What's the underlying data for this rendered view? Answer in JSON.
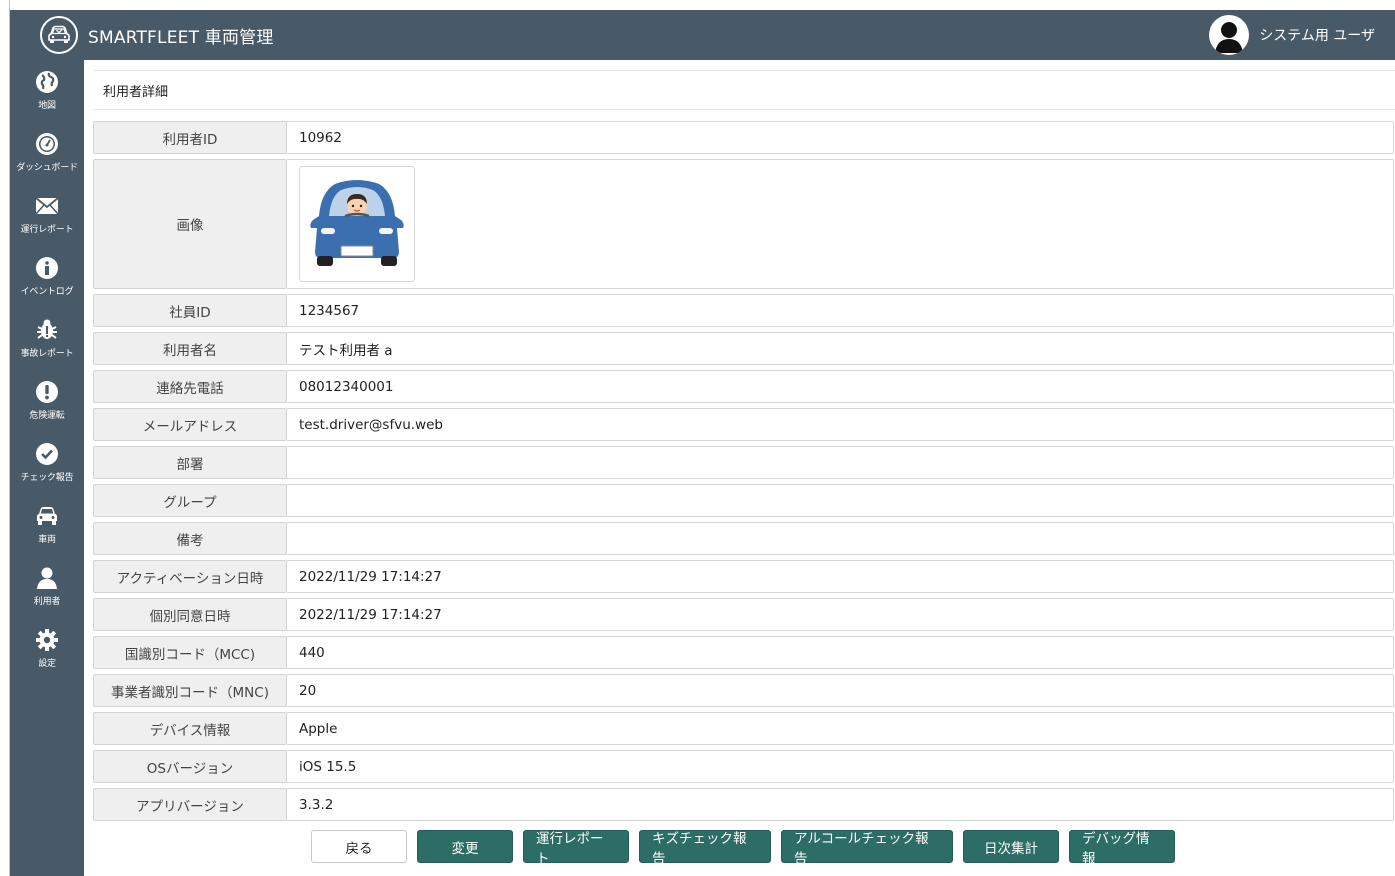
{
  "header": {
    "app_title": "SMARTFLEET 車両管理",
    "user_name": "システム用 ユーザ"
  },
  "sidebar": {
    "items": [
      {
        "label": "地図",
        "icon": "globe-icon"
      },
      {
        "label": "ダッシュボード",
        "icon": "dashboard-icon"
      },
      {
        "label": "運行レポート",
        "icon": "envelope-icon"
      },
      {
        "label": "イベントログ",
        "icon": "info-icon"
      },
      {
        "label": "事故レポート",
        "icon": "bug-icon"
      },
      {
        "label": "危険運転",
        "icon": "exclamation-icon"
      },
      {
        "label": "チェック報告",
        "icon": "check-circle-icon"
      },
      {
        "label": "車両",
        "icon": "car-icon"
      },
      {
        "label": "利用者",
        "icon": "user-icon"
      },
      {
        "label": "設定",
        "icon": "gear-icon"
      }
    ]
  },
  "page": {
    "title": "利用者詳細"
  },
  "details": {
    "user_id": {
      "label": "利用者ID",
      "value": "10962"
    },
    "image": {
      "label": "画像"
    },
    "employee_id": {
      "label": "社員ID",
      "value": "1234567"
    },
    "user_name": {
      "label": "利用者名",
      "value": "テスト利用者 a"
    },
    "phone": {
      "label": "連絡先電話",
      "value": "08012340001"
    },
    "email": {
      "label": "メールアドレス",
      "value": "test.driver@sfvu.web"
    },
    "department": {
      "label": "部署",
      "value": ""
    },
    "group": {
      "label": "グループ",
      "value": ""
    },
    "notes": {
      "label": "備考",
      "value": ""
    },
    "activation_datetime": {
      "label": "アクティベーション日時",
      "value": "2022/11/29 17:14:27"
    },
    "consent_datetime": {
      "label": "個別同意日時",
      "value": "2022/11/29 17:14:27"
    },
    "mcc": {
      "label": "国識別コード（MCC)",
      "value": "440"
    },
    "mnc": {
      "label": "事業者識別コード（MNC)",
      "value": "20"
    },
    "device_info": {
      "label": "デバイス情報",
      "value": "Apple"
    },
    "os_version": {
      "label": "OSバージョン",
      "value": "iOS 15.5"
    },
    "app_version": {
      "label": "アプリバージョン",
      "value": "3.3.2"
    }
  },
  "buttons": {
    "back": "戻る",
    "edit": "変更",
    "operation_report": "運行レポート",
    "kids_check": "キズチェック報告",
    "alcohol_check": "アルコールチェック報告",
    "daily_summary": "日次集計",
    "debug_info": "デバッグ情報"
  },
  "colors": {
    "header_bg": "#485a68",
    "accent_teal": "#2c6e66",
    "label_bg": "#efefef"
  }
}
